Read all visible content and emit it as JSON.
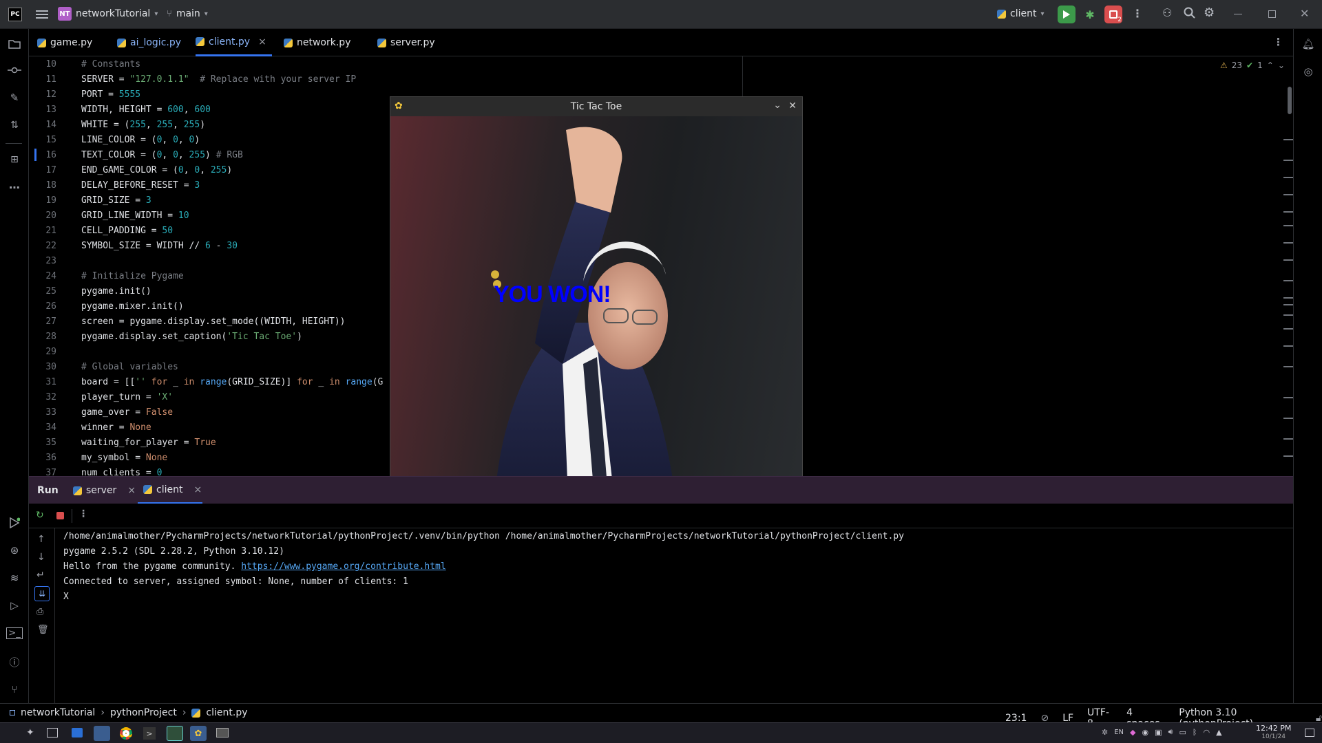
{
  "titlebar": {
    "app_badge": "PC",
    "project_badge": "NT",
    "project_name": "networkTutorial",
    "branch": "main",
    "run_config": "client",
    "debug_badge": "2",
    "colors": {
      "run_green": "#3c9a4a",
      "stop_red": "#d94e4e",
      "project_badge": "#b05fc8"
    }
  },
  "tabs": [
    {
      "label": "game.py"
    },
    {
      "label": "ai_logic.py"
    },
    {
      "label": "client.py",
      "close": "×"
    },
    {
      "label": "network.py"
    },
    {
      "label": "server.py"
    }
  ],
  "inspection": {
    "warnings": "23",
    "checks": "1"
  },
  "editor": {
    "lines": [
      {
        "n": "10",
        "html": "<span class=cmt># Constants</span>"
      },
      {
        "n": "11",
        "html": "SERVER = <span class=str>\"127.0.1.1\"</span>  <span class=cmt># Replace with your server IP</span>"
      },
      {
        "n": "12",
        "html": "PORT = <span class=num>5555</span>"
      },
      {
        "n": "13",
        "html": "WIDTH, HEIGHT = <span class=num>600</span>, <span class=num>600</span>"
      },
      {
        "n": "14",
        "html": "WHITE = (<span class=num>255</span>, <span class=num>255</span>, <span class=num>255</span>)"
      },
      {
        "n": "15",
        "html": "LINE_COLOR = (<span class=num>0</span>, <span class=num>0</span>, <span class=num>0</span>)"
      },
      {
        "n": "16",
        "html": "TEXT_COLOR = (<span class=num>0</span>, <span class=num>0</span>, <span class=num>255</span>) <span class=cmt># RGB</span>"
      },
      {
        "n": "17",
        "html": "END_GAME_COLOR = (<span class=num>0</span>, <span class=num>0</span>, <span class=num>255</span>)"
      },
      {
        "n": "18",
        "html": "DELAY_BEFORE_RESET = <span class=num>3</span>"
      },
      {
        "n": "19",
        "html": "GRID_SIZE = <span class=num>3</span>"
      },
      {
        "n": "20",
        "html": "GRID_LINE_WIDTH = <span class=num>10</span>"
      },
      {
        "n": "21",
        "html": "CELL_PADDING = <span class=num>50</span>"
      },
      {
        "n": "22",
        "html": "SYMBOL_SIZE = WIDTH // <span class=num>6</span> - <span class=num>30</span>"
      },
      {
        "n": "23",
        "html": ""
      },
      {
        "n": "24",
        "html": "<span class=cmt># Initialize Pygame</span>"
      },
      {
        "n": "25",
        "html": "pygame.init()"
      },
      {
        "n": "26",
        "html": "pygame.mixer.init()"
      },
      {
        "n": "27",
        "html": "screen = pygame.display.set_mode((WIDTH, HEIGHT))"
      },
      {
        "n": "28",
        "html": "pygame.display.set_caption(<span class=str>'Tic Tac Toe'</span>)"
      },
      {
        "n": "29",
        "html": ""
      },
      {
        "n": "30",
        "html": "<span class=cmt># Global variables</span>"
      },
      {
        "n": "31",
        "html": "board = [[<span class=str>''</span> <span class=kw>for</span> _ <span class=kw>in</span> <span class=fn>range</span>(GRID_SIZE)] <span class=kw>for</span> _ <span class=kw>in</span> <span class=fn>range</span>(G"
      },
      {
        "n": "32",
        "html": "player_turn = <span class=str>'X'</span>"
      },
      {
        "n": "33",
        "html": "game_over = <span class=kw>False</span>"
      },
      {
        "n": "34",
        "html": "winner = <span class=kw>None</span>"
      },
      {
        "n": "35",
        "html": "waiting_for_player = <span class=kw>True</span>"
      },
      {
        "n": "36",
        "html": "my_symbol = <span class=kw>None</span>"
      },
      {
        "n": "37",
        "html": "num_clients = <span class=num>0</span>"
      }
    ]
  },
  "run_panel": {
    "title": "Run",
    "tabs": [
      {
        "label": "server"
      },
      {
        "label": "client"
      }
    ],
    "console": [
      "/home/animalmother/PycharmProjects/networkTutorial/pythonProject/.venv/bin/python /home/animalmother/PycharmProjects/networkTutorial/pythonProject/client.py",
      "pygame 2.5.2 (SDL 2.28.2, Python 3.10.12)",
      "Hello from the pygame community. ",
      "Connected to server, assigned symbol: None, number of clients: 1",
      "X"
    ],
    "link": "https://www.pygame.org/contribute.html"
  },
  "game_window": {
    "title": "Tic Tac Toe",
    "message": "YOU WON!",
    "message_color": "#0000ff"
  },
  "statusbar": {
    "crumbs": [
      "networkTutorial",
      "pythonProject",
      "client.py"
    ],
    "position": "23:1",
    "line_sep": "LF",
    "encoding": "UTF-8",
    "indent": "4 spaces",
    "interpreter": "Python 3.10 (pythonProject)"
  },
  "taskbar": {
    "lang": "EN",
    "time": "12:42 PM",
    "date": "10/1/24"
  }
}
